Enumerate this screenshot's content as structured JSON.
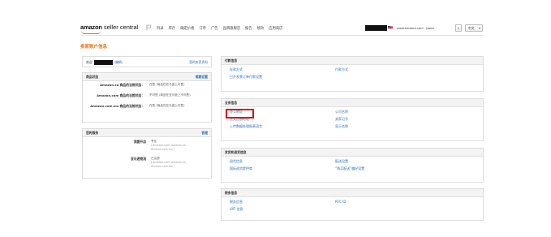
{
  "header": {
    "logo_prefix": "amazon",
    "logo_suffix": "seller central",
    "nav": [
      "目录",
      "库存",
      "确定价格",
      "订单",
      "广告",
      "品牌旗舰店",
      "报告",
      "绩效",
      "应用商店"
    ],
    "marketplace": "www.amazon.com - Jason",
    "language": "中文"
  },
  "page_title": "卖家账户信息",
  "welcome": {
    "label": "欢迎",
    "edit": "(编辑)",
    "profile_link": "您的卖家资料"
  },
  "listing_status": {
    "title": "商品状态",
    "action": "假期设置",
    "rows": [
      {
        "label": "Amazon.ca 商品的当前状态：",
        "value": "在售 (商品在亚马逊上可售)"
      },
      {
        "label": "Amazon.com 商品的当前状态：",
        "value": "不可售 (商品在亚马逊上不可售)"
      },
      {
        "label": "Amazon.com.mx 商品的当前状态：",
        "value": "在售 (商品在亚马逊上可售)"
      }
    ]
  },
  "services": {
    "title": "您的服务",
    "action": "管理",
    "rows": [
      {
        "label": "我要开店",
        "value": "专业",
        "sub": "( Amazon.com, Amazon.ca, Amazon.com.mx )"
      },
      {
        "label": "亚马逊物流",
        "value": "已注册",
        "sub": "( Amazon.com, Amazon.ca, Amazon.com.mx )"
      }
    ]
  },
  "payment": {
    "title": "付款信息",
    "links": [
      "存款方式",
      "付款方式",
      "已开发票订单付款设置"
    ]
  },
  "business": {
    "title": "业务信息",
    "links": [
      "办公地址",
      "公司名称",
      "正式注册地址",
      "卖家记号",
      "上传数据处理报表语言",
      "显示名称"
    ]
  },
  "shipping": {
    "title": "发货和退货信息",
    "links": [
      "退货信息",
      "配送设置",
      "国际退货提供商",
      "“购买配送”偏好设置"
    ]
  },
  "tax": {
    "title": "税务信息",
    "links": [
      "税务信息",
      "RFC ID",
      "VAT 信息"
    ]
  }
}
